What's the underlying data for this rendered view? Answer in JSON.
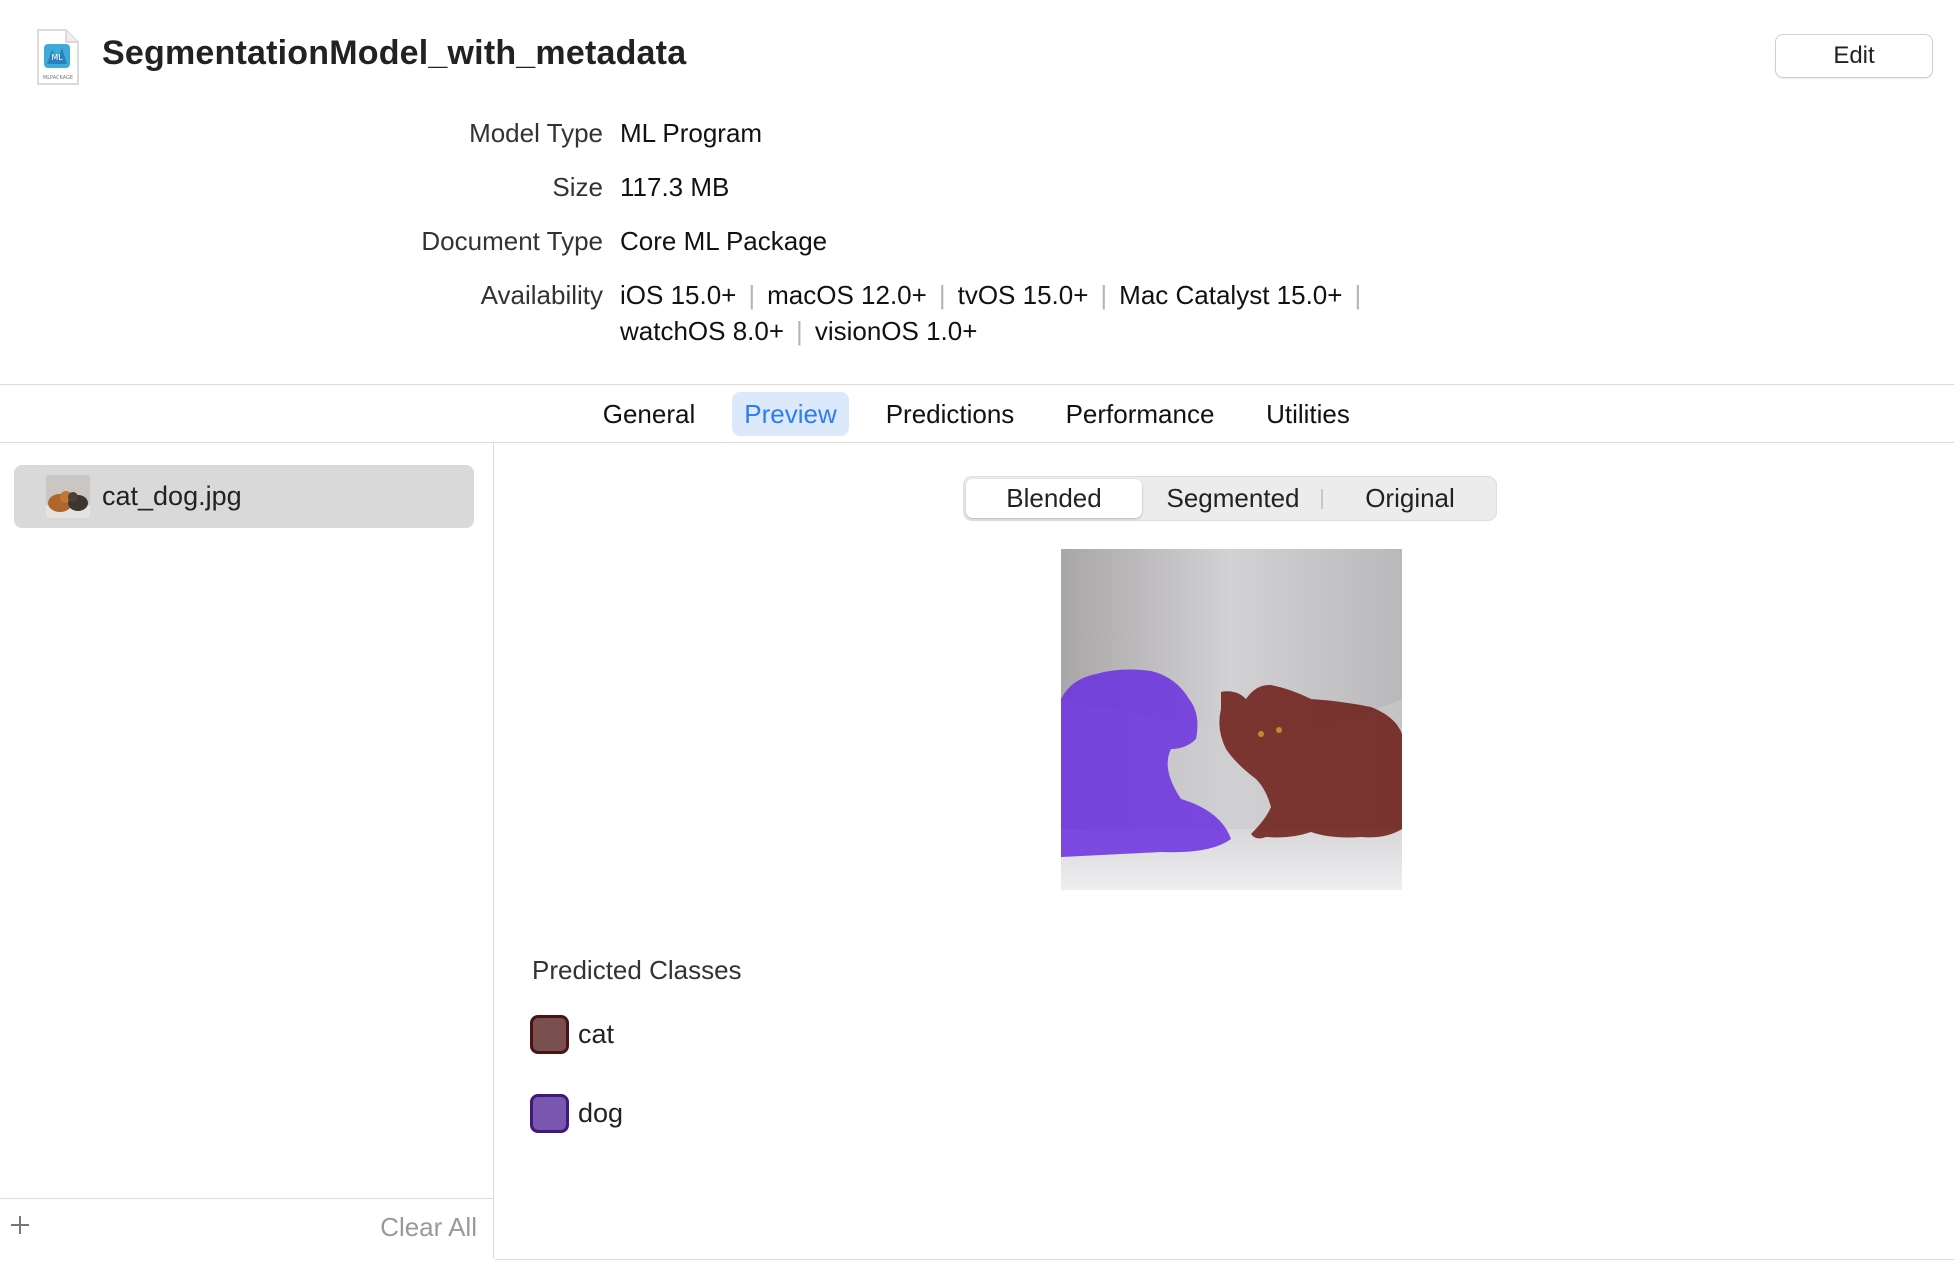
{
  "header": {
    "title": "SegmentationModel_with_metadata",
    "file_icon_caption": "MLPACKAGE",
    "edit_label": "Edit"
  },
  "metadata": {
    "model_type_label": "Model Type",
    "model_type_value": "ML Program",
    "size_label": "Size",
    "size_value": "117.3 MB",
    "document_type_label": "Document Type",
    "document_type_value": "Core ML Package",
    "availability_label": "Availability",
    "availability": [
      "iOS 15.0+",
      "macOS 12.0+",
      "tvOS 15.0+",
      "Mac Catalyst 15.0+",
      "watchOS 8.0+",
      "visionOS 1.0+"
    ]
  },
  "tabs": [
    {
      "label": "General"
    },
    {
      "label": "Preview",
      "active": true
    },
    {
      "label": "Predictions"
    },
    {
      "label": "Performance"
    },
    {
      "label": "Utilities"
    }
  ],
  "sidebar": {
    "items": [
      {
        "label": "cat_dog.jpg",
        "selected": true
      }
    ],
    "add_icon": "plus-icon",
    "clear_all_label": "Clear All"
  },
  "preview": {
    "view_modes": [
      {
        "label": "Blended",
        "active": true
      },
      {
        "label": "Segmented"
      },
      {
        "label": "Original"
      }
    ],
    "predicted_classes_label": "Predicted Classes",
    "classes": [
      {
        "label": "cat",
        "color": "#7a4f4f",
        "border": "#4a1416"
      },
      {
        "label": "dog",
        "color": "#7a57ae",
        "border": "#3f1a7e"
      }
    ]
  },
  "colors": {
    "accent": "#2d7cf6",
    "cat_overlay": "#6b1a14",
    "dog_overlay": "#6a2fe0"
  }
}
